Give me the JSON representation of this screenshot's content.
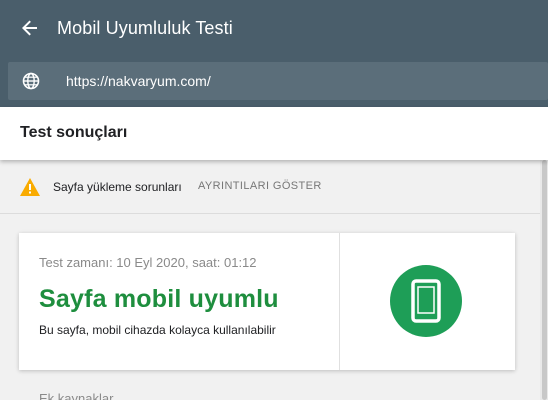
{
  "header": {
    "title": "Mobil Uyumluluk Testi",
    "back_icon": "arrow-left-icon",
    "url": "https://nakvaryum.com/",
    "url_icon": "globe-icon"
  },
  "results": {
    "title": "Test sonuçları"
  },
  "warning": {
    "icon": "warning-icon",
    "text": "Sayfa yükleme sorunları",
    "link": "AYRINTILARI GÖSTER"
  },
  "card": {
    "test_time": "Test zamanı: 10 Eyl 2020, saat: 01:12",
    "result_title": "Sayfa mobil uyumlu",
    "result_subtitle": "Bu sayfa, mobil cihazda kolayca kullanılabilir",
    "badge_icon": "smartphone-icon"
  },
  "more": {
    "heading": "Ek kaynaklar"
  },
  "colors": {
    "topbar": "#4a5e6b",
    "success": "#1e8e3e",
    "badge": "#1e9e57",
    "warning": "#f9ab00"
  }
}
